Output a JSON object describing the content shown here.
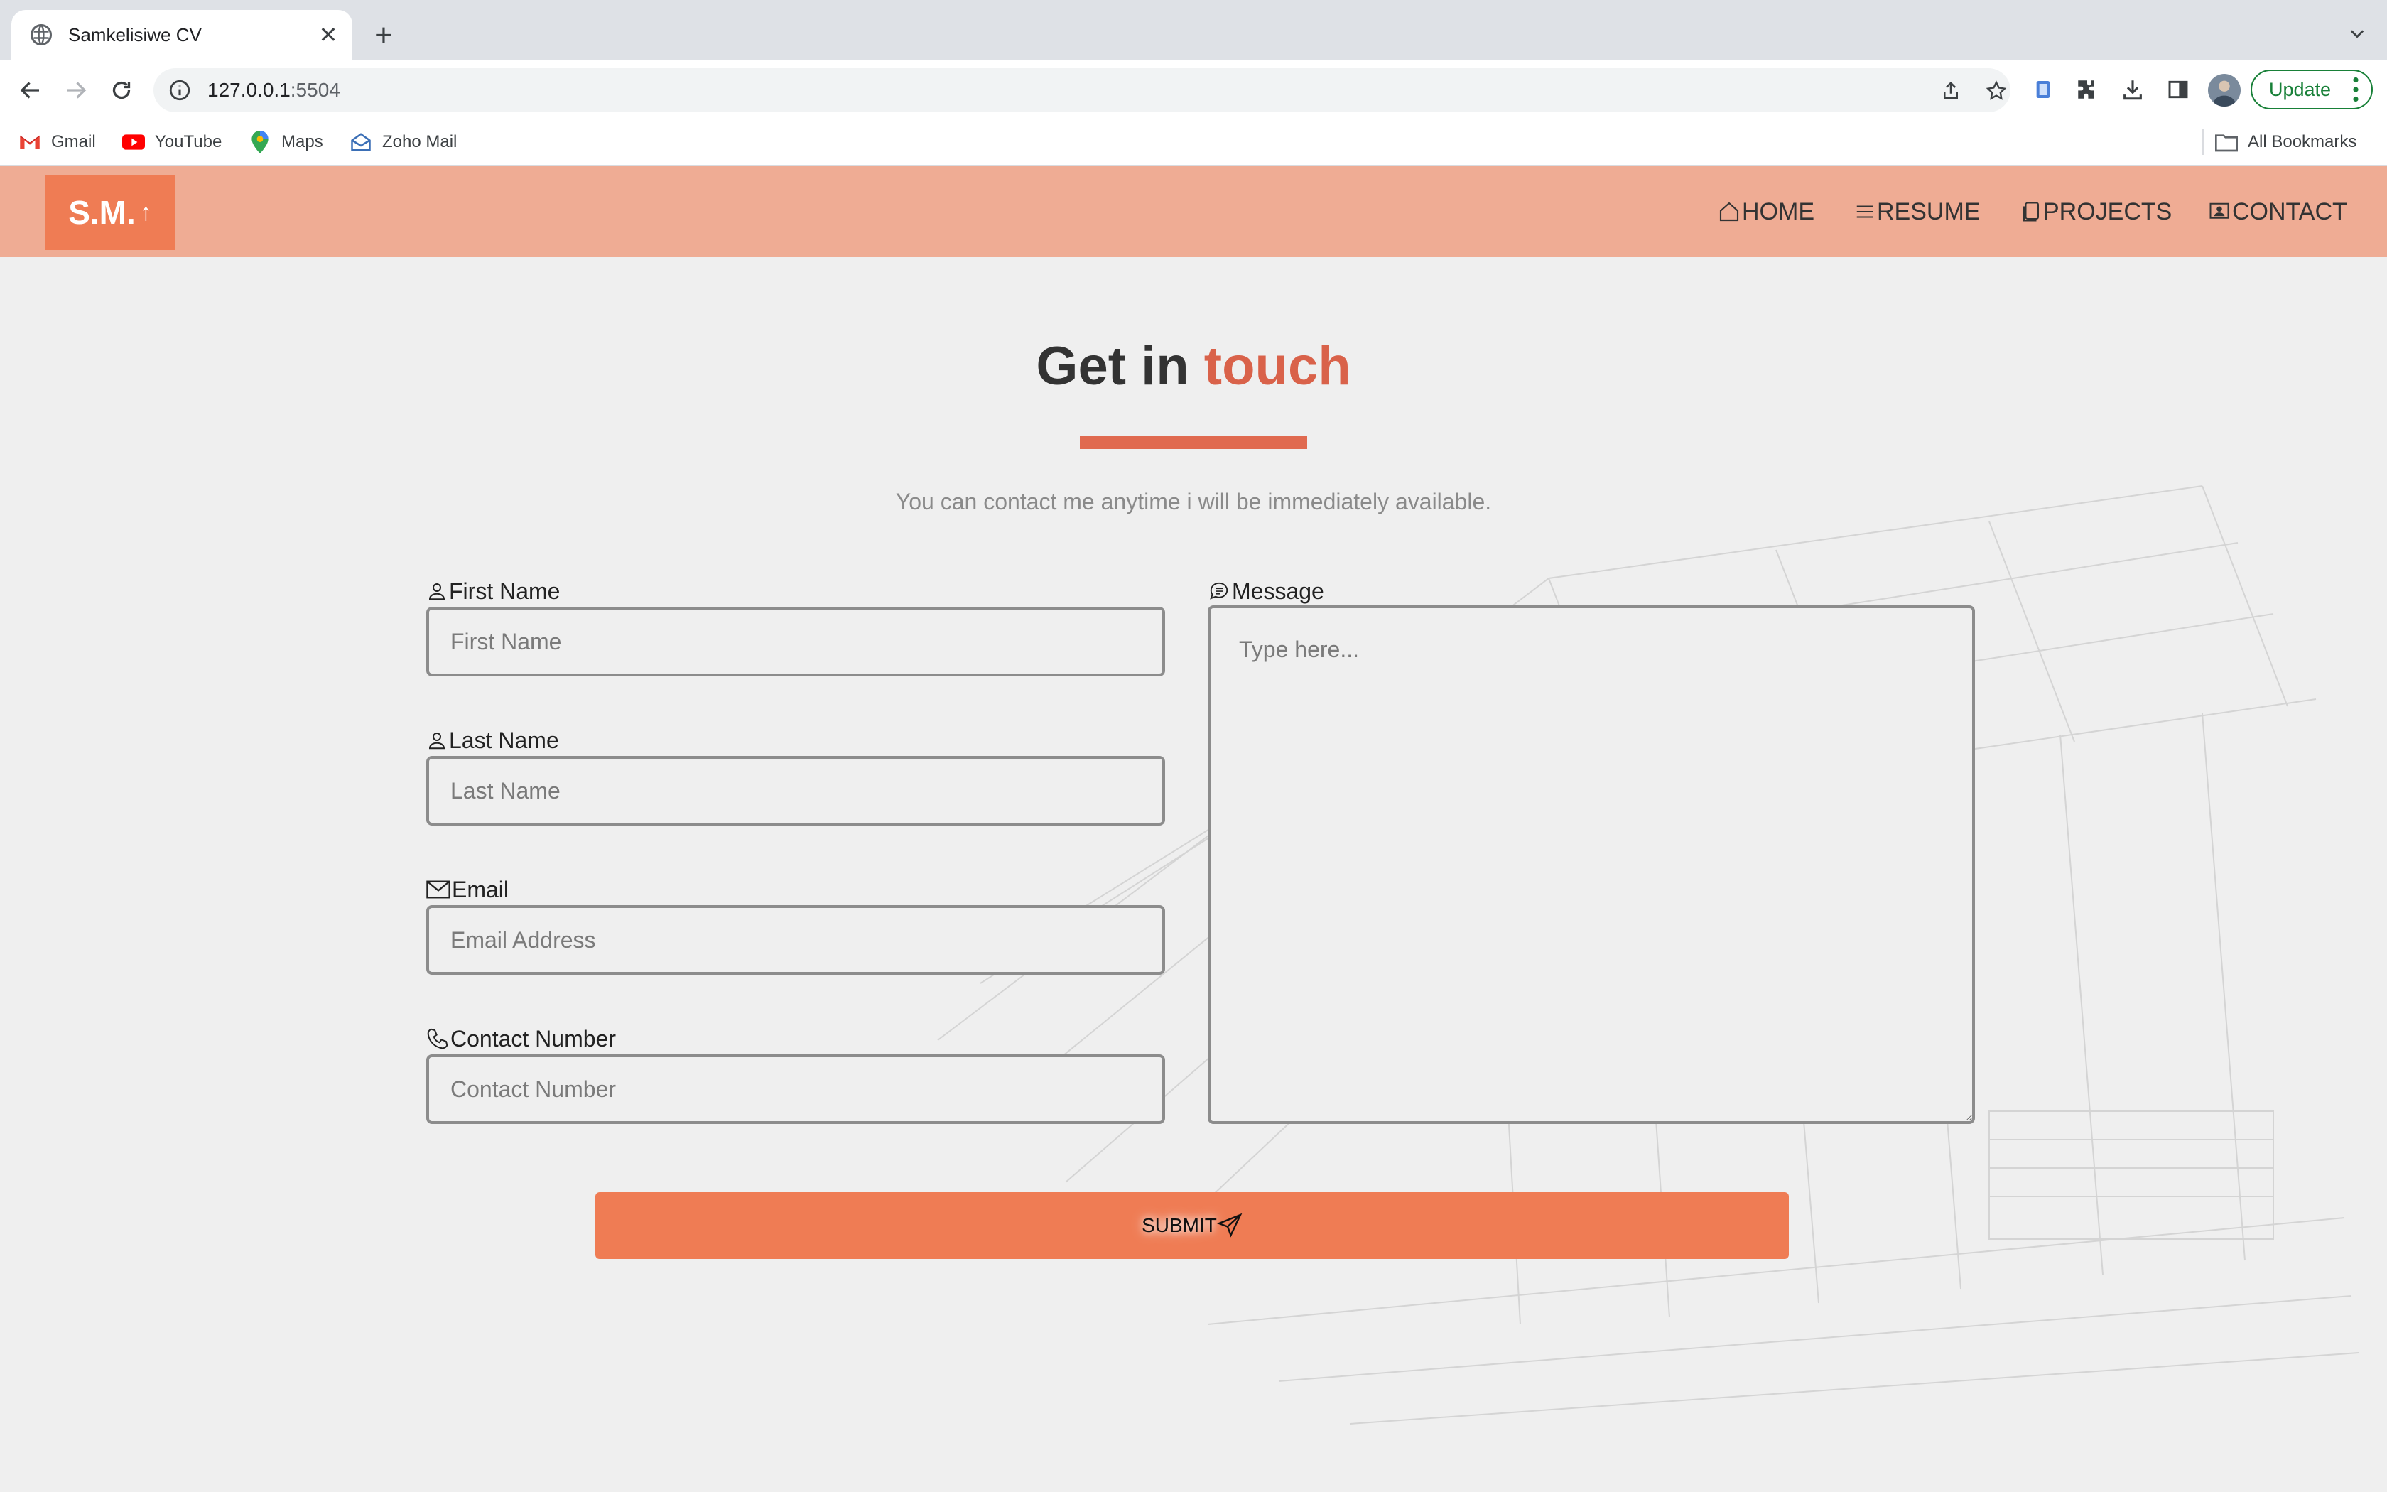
{
  "browser": {
    "tab_title": "Samkelisiwe CV",
    "url_host": "127.0.0.1",
    "url_port": ":5504",
    "update_label": "Update",
    "bookmarks": [
      "Gmail",
      "YouTube",
      "Maps",
      "Zoho Mail"
    ],
    "all_bookmarks": "All Bookmarks"
  },
  "site": {
    "logo_text": "S.M.",
    "logo_arrow": "↑",
    "nav": {
      "home": "HOME",
      "resume": "RESUME",
      "projects": "PROJECTS",
      "contact": "CONTACT"
    },
    "accent_color": "#ef7c54"
  },
  "contact": {
    "heading_main": "Get in ",
    "heading_accent": "touch",
    "subtitle": "You can contact me anytime i will be immediately available.",
    "first_name": {
      "label": "First Name",
      "placeholder": "First Name",
      "value": ""
    },
    "last_name": {
      "label": "Last Name",
      "placeholder": "Last Name",
      "value": ""
    },
    "email": {
      "label": "Email",
      "placeholder": "Email Address",
      "value": ""
    },
    "phone": {
      "label": "Contact Number",
      "placeholder": "Contact Number",
      "value": ""
    },
    "message": {
      "label": "Message",
      "placeholder": "Type here...",
      "value": ""
    },
    "submit_label": "SUBMIT"
  }
}
